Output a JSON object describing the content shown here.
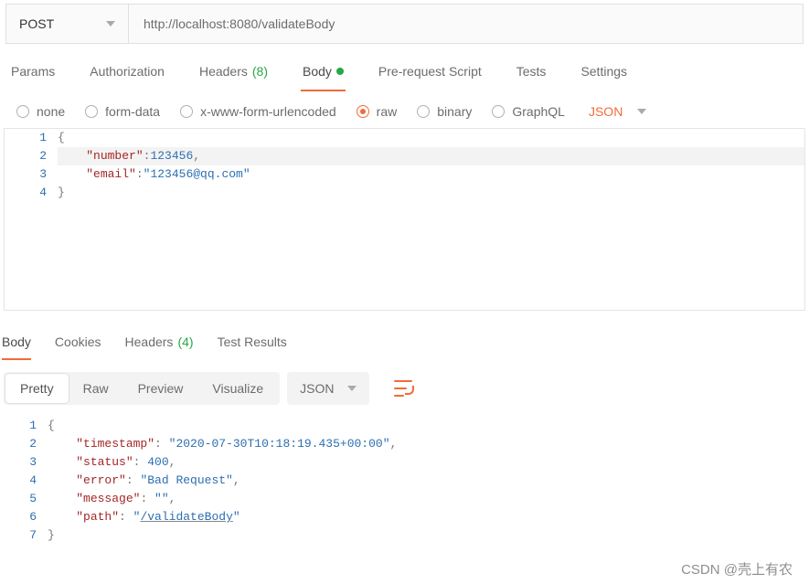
{
  "request": {
    "method": "POST",
    "url": "http://localhost:8080/validateBody"
  },
  "request_tabs": {
    "params": "Params",
    "authorization": "Authorization",
    "headers_label": "Headers",
    "headers_count": "(8)",
    "body": "Body",
    "prerequest": "Pre-request Script",
    "tests": "Tests",
    "settings": "Settings"
  },
  "body_types": {
    "none": "none",
    "form_data": "form-data",
    "x_www": "x-www-form-urlencoded",
    "raw": "raw",
    "binary": "binary",
    "graphql": "GraphQL"
  },
  "body_language": "JSON",
  "body_code": {
    "lines": [
      "1",
      "2",
      "3",
      "4"
    ],
    "l1_open": "{",
    "l2_indent": "    ",
    "l2_key": "\"number\"",
    "l2_colon": ":",
    "l2_val": "123456",
    "l2_comma": ",",
    "l3_indent": "    ",
    "l3_key": "\"email\"",
    "l3_colon": ":",
    "l3_val": "\"123456@qq.com\"",
    "l4_close": "}"
  },
  "response_tabs": {
    "body": "Body",
    "cookies": "Cookies",
    "headers_label": "Headers",
    "headers_count": "(4)",
    "test_results": "Test Results"
  },
  "response_views": {
    "pretty": "Pretty",
    "raw": "Raw",
    "preview": "Preview",
    "visualize": "Visualize"
  },
  "response_format": "JSON",
  "response_body": {
    "lines": [
      "1",
      "2",
      "3",
      "4",
      "5",
      "6",
      "7"
    ],
    "l1_open": "{",
    "ts_key": "\"timestamp\"",
    "ts_val": "\"2020-07-30T10:18:19.435+00:00\"",
    "status_key": "\"status\"",
    "status_val": "400",
    "error_key": "\"error\"",
    "error_val": "\"Bad Request\"",
    "message_key": "\"message\"",
    "message_val": "\"\"",
    "path_key": "\"path\"",
    "path_val_q1": "\"",
    "path_val_mid": "/validateBody",
    "path_val_q2": "\"",
    "colon": ": ",
    "comma": ",",
    "indent": "    ",
    "close": "}"
  },
  "watermark": "CSDN @壳上有农"
}
